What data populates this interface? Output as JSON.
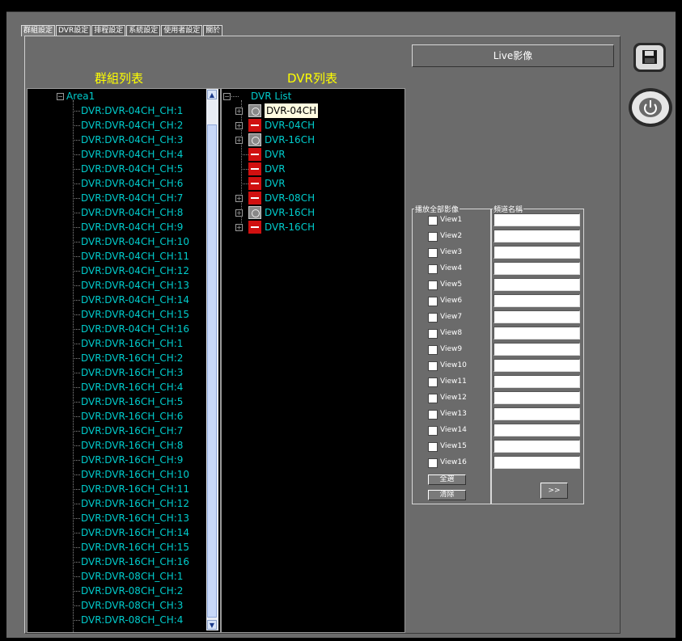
{
  "tabs": [
    "群組設定",
    "DVR設定",
    "排程設定",
    "系統設定",
    "使用者設定",
    "關於"
  ],
  "group_header": "群組列表",
  "dvr_header": "DVR列表",
  "group_tree": {
    "root": "Area1",
    "items": [
      "DVR:DVR-04CH_CH:1",
      "DVR:DVR-04CH_CH:2",
      "DVR:DVR-04CH_CH:3",
      "DVR:DVR-04CH_CH:4",
      "DVR:DVR-04CH_CH:5",
      "DVR:DVR-04CH_CH:6",
      "DVR:DVR-04CH_CH:7",
      "DVR:DVR-04CH_CH:8",
      "DVR:DVR-04CH_CH:9",
      "DVR:DVR-04CH_CH:10",
      "DVR:DVR-04CH_CH:11",
      "DVR:DVR-04CH_CH:12",
      "DVR:DVR-04CH_CH:13",
      "DVR:DVR-04CH_CH:14",
      "DVR:DVR-04CH_CH:15",
      "DVR:DVR-04CH_CH:16",
      "DVR:DVR-16CH_CH:1",
      "DVR:DVR-16CH_CH:2",
      "DVR:DVR-16CH_CH:3",
      "DVR:DVR-16CH_CH:4",
      "DVR:DVR-16CH_CH:5",
      "DVR:DVR-16CH_CH:6",
      "DVR:DVR-16CH_CH:7",
      "DVR:DVR-16CH_CH:8",
      "DVR:DVR-16CH_CH:9",
      "DVR:DVR-16CH_CH:10",
      "DVR:DVR-16CH_CH:11",
      "DVR:DVR-16CH_CH:12",
      "DVR:DVR-16CH_CH:13",
      "DVR:DVR-16CH_CH:14",
      "DVR:DVR-16CH_CH:15",
      "DVR:DVR-16CH_CH:16",
      "DVR:DVR-08CH_CH:1",
      "DVR:DVR-08CH_CH:2",
      "DVR:DVR-08CH_CH:3",
      "DVR:DVR-08CH_CH:4"
    ]
  },
  "dvr_tree": {
    "root": "DVR List",
    "items": [
      {
        "label": "DVR-04CH",
        "icon": "dvr-online-icon",
        "expand": true,
        "selected": true
      },
      {
        "label": "DVR-04CH",
        "icon": "dvr-offline-icon",
        "expand": true,
        "selected": false
      },
      {
        "label": "DVR-16CH",
        "icon": "dvr-online-icon",
        "expand": true,
        "selected": false
      },
      {
        "label": "DVR",
        "icon": "dvr-offline-icon",
        "expand": false,
        "selected": false
      },
      {
        "label": "DVR",
        "icon": "dvr-offline-icon",
        "expand": false,
        "selected": false
      },
      {
        "label": "DVR",
        "icon": "dvr-offline-icon",
        "expand": false,
        "selected": false
      },
      {
        "label": "DVR-08CH",
        "icon": "dvr-offline-icon",
        "expand": true,
        "selected": false
      },
      {
        "label": "DVR-16CH",
        "icon": "dvr-online-icon",
        "expand": true,
        "selected": false
      },
      {
        "label": "DVR-16CH",
        "icon": "dvr-offline-icon",
        "expand": true,
        "selected": false
      }
    ]
  },
  "live_label": "Live影像",
  "play_all_group": "播放全部影像",
  "channel_name_group": "頻道名稱",
  "views": [
    "View1",
    "View2",
    "View3",
    "View4",
    "View5",
    "View6",
    "View7",
    "View8",
    "View9",
    "View10",
    "View11",
    "View12",
    "View13",
    "View14",
    "View15",
    "View16"
  ],
  "select_all_label": "全選",
  "clear_label": "清除",
  "apply_label": ">>",
  "colors": {
    "tree_text": "#00cccc",
    "header": "#ffff00",
    "panel": "#6b6b6b"
  }
}
